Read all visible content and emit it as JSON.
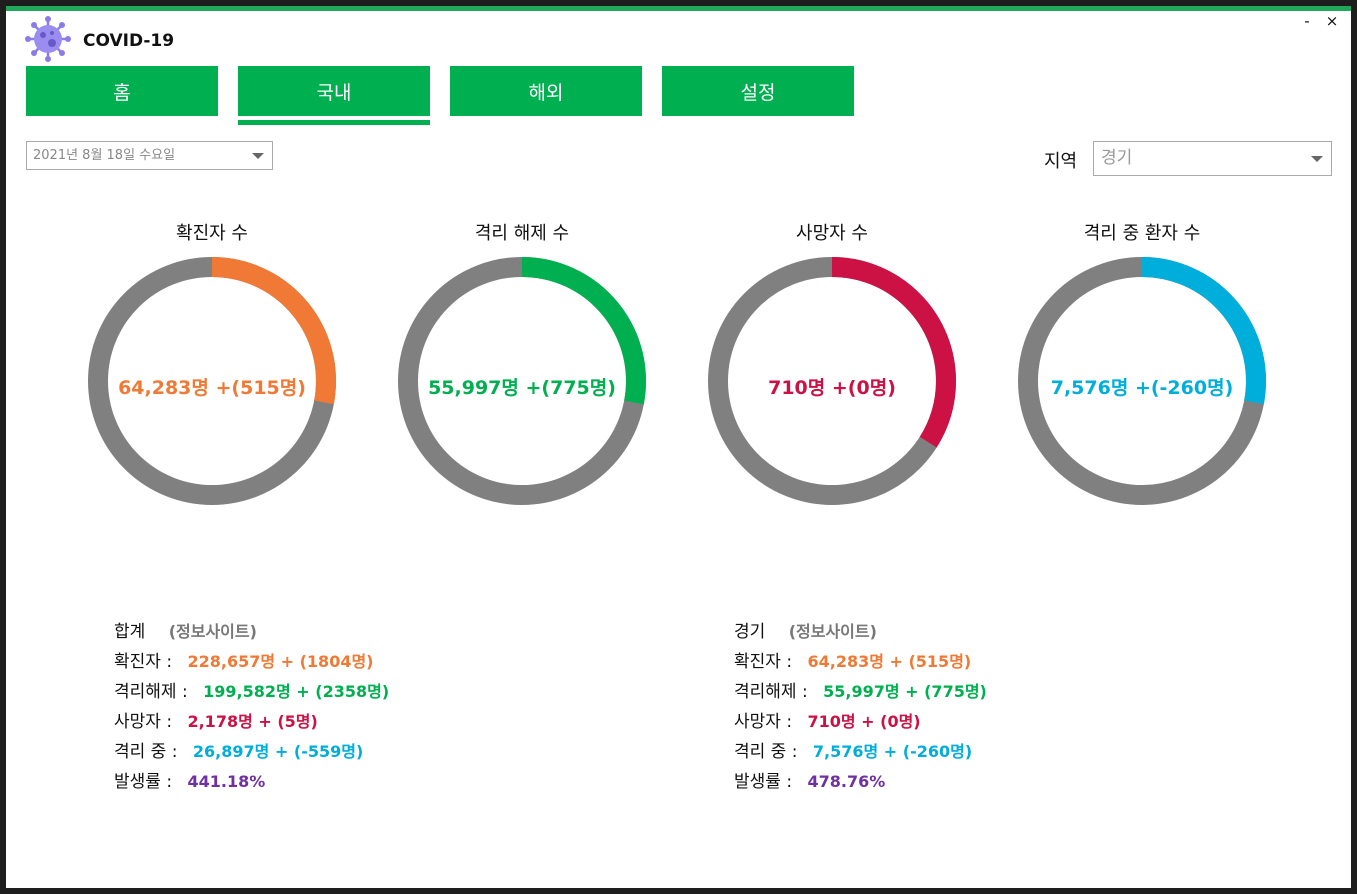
{
  "app": {
    "title": "COVID-19",
    "minimize": "-",
    "close": "×"
  },
  "tabs": [
    {
      "label": "홈"
    },
    {
      "label": "국내"
    },
    {
      "label": "해외"
    },
    {
      "label": "설정"
    }
  ],
  "active_tab": "국내",
  "date_select": {
    "value": "2021년 8월 18일 수요일"
  },
  "region": {
    "label": "지역",
    "value": "경기"
  },
  "colors": {
    "confirmed": "#f07a35",
    "released": "#00b050",
    "deaths": "#cc1144",
    "isolated": "#00aedb",
    "rate": "#7030a0",
    "ring_bg": "#808080",
    "accent": "#00b050"
  },
  "donuts": [
    {
      "title": "확진자 수",
      "count": "64,283",
      "unit": "명",
      "delta": "+(515",
      "delta_unit": "명)",
      "color": "#f07a35",
      "fraction": 0.28
    },
    {
      "title": "격리 해제 수",
      "count": "55,997",
      "unit": "명",
      "delta": "+(775",
      "delta_unit": "명)",
      "color": "#00b050",
      "fraction": 0.28
    },
    {
      "title": "사망자 수",
      "count": "710",
      "unit": "명",
      "delta": "+(0",
      "delta_unit": "명)",
      "color": "#cc1144",
      "fraction": 0.34
    },
    {
      "title": "격리 중 환자 수",
      "count": "7,576",
      "unit": "명",
      "delta": "+(-260",
      "delta_unit": "명)",
      "color": "#00aedb",
      "fraction": 0.28
    }
  ],
  "summary_total": {
    "title": "합계",
    "site_link": "(정보사이트)",
    "rows": [
      {
        "label": "확진자 :",
        "value": "228,657명 + (1804명)",
        "color": "#f07a35"
      },
      {
        "label": "격리해제 :",
        "value": "199,582명 + (2358명)",
        "color": "#00b050"
      },
      {
        "label": "사망자 :",
        "value": "2,178명 + (5명)",
        "color": "#cc1144"
      },
      {
        "label": "격리 중 :",
        "value": "26,897명 + (-559명)",
        "color": "#00aedb"
      },
      {
        "label": "발생률 :",
        "value": "441.18%",
        "color": "#7030a0"
      }
    ]
  },
  "summary_region": {
    "title": "경기",
    "site_link": "(정보사이트)",
    "rows": [
      {
        "label": "확진자 :",
        "value": "64,283명 + (515명)",
        "color": "#f07a35"
      },
      {
        "label": "격리해제 :",
        "value": "55,997명 + (775명)",
        "color": "#00b050"
      },
      {
        "label": "사망자 :",
        "value": "710명 + (0명)",
        "color": "#cc1144"
      },
      {
        "label": "격리 중 :",
        "value": "7,576명 + (-260명)",
        "color": "#00aedb"
      },
      {
        "label": "발생률 :",
        "value": "478.76%",
        "color": "#7030a0"
      }
    ]
  }
}
